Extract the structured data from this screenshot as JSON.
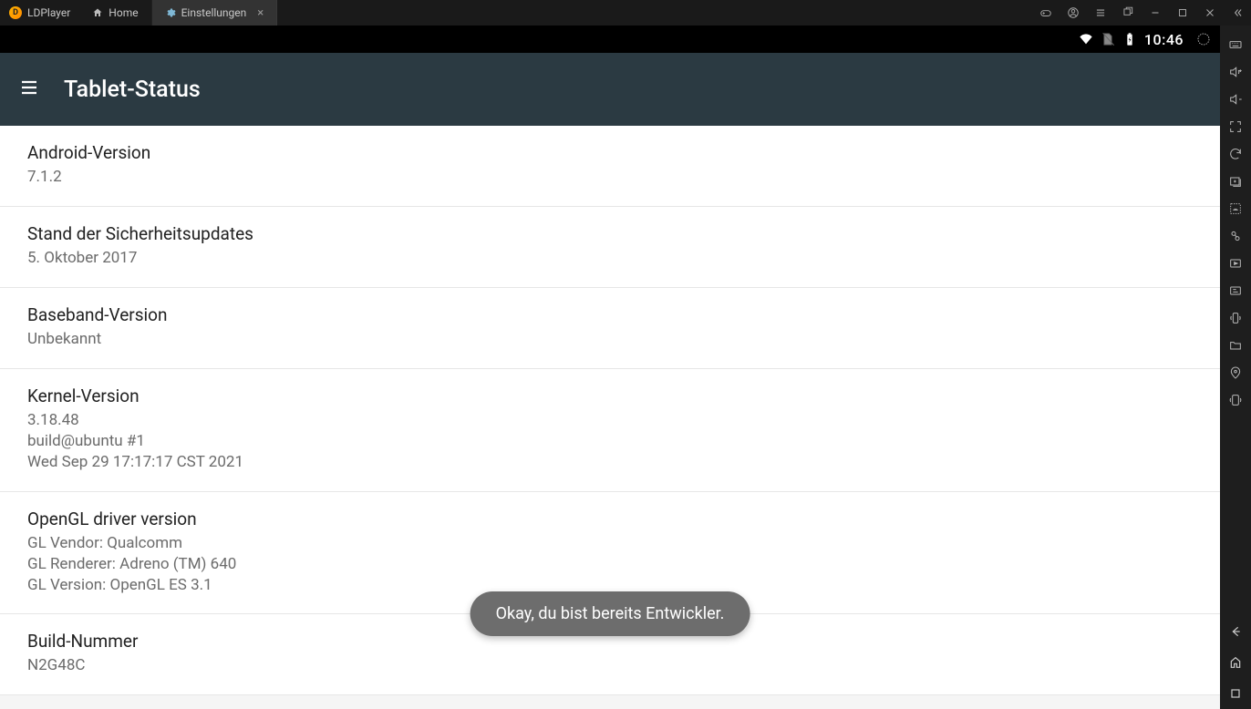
{
  "window": {
    "app_name": "LDPlayer",
    "tabs": [
      {
        "label": "Home",
        "icon": "home-icon",
        "active": false
      },
      {
        "label": "Einstellungen",
        "icon": "gear-icon",
        "active": true
      }
    ]
  },
  "status_bar": {
    "time": "10:46"
  },
  "header": {
    "title": "Tablet-Status"
  },
  "items": [
    {
      "title": "Android-Version",
      "value": "7.1.2"
    },
    {
      "title": "Stand der Sicherheitsupdates",
      "value": "5. Oktober 2017"
    },
    {
      "title": "Baseband-Version",
      "value": "Unbekannt"
    },
    {
      "title": "Kernel-Version",
      "value": "3.18.48\nbuild@ubuntu #1\nWed Sep 29 17:17:17 CST 2021"
    },
    {
      "title": "OpenGL driver version",
      "value": "GL Vendor: Qualcomm\nGL Renderer: Adreno (TM) 640\nGL Version: OpenGL ES 3.1"
    },
    {
      "title": "Build-Nummer",
      "value": "N2G48C"
    }
  ],
  "toast": {
    "message": "Okay, du bist bereits Entwickler."
  }
}
